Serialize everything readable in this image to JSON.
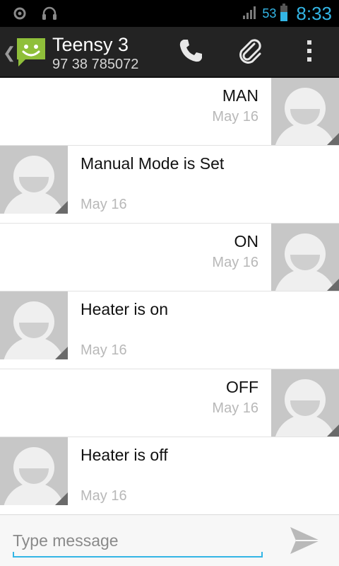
{
  "status_bar": {
    "battery_percent": "53",
    "time": "8:33",
    "icons": [
      "sync-icon",
      "headset-icon",
      "signal-icon",
      "battery-icon"
    ],
    "accent_color": "#33b5e5"
  },
  "action_bar": {
    "contact_name": "Teensy 3",
    "contact_number": "97 38 785072",
    "icons": [
      "messaging-app-icon",
      "phone-icon",
      "attach-icon",
      "overflow-menu-icon"
    ]
  },
  "messages": [
    {
      "direction": "sent",
      "text": "MAN",
      "date": "May 16"
    },
    {
      "direction": "received",
      "text": "Manual Mode is Set",
      "date": "May 16"
    },
    {
      "direction": "sent",
      "text": "ON",
      "date": "May 16"
    },
    {
      "direction": "received",
      "text": "Heater is on",
      "date": "May 16"
    },
    {
      "direction": "sent",
      "text": "OFF",
      "date": "May 16"
    },
    {
      "direction": "received",
      "text": "Heater is off",
      "date": "May 16"
    }
  ],
  "compose": {
    "placeholder": "Type message",
    "value": "",
    "send_icon": "send-icon"
  }
}
